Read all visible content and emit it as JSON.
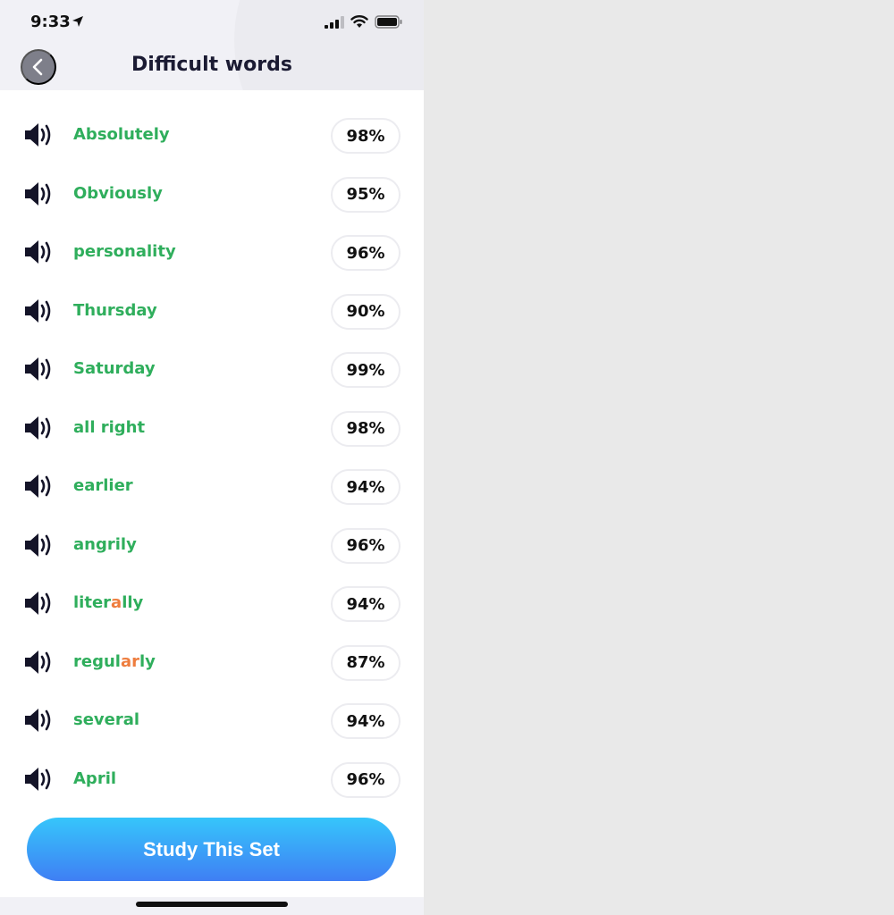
{
  "status_bar": {
    "time": "9:33",
    "icons": [
      "location-arrow-icon",
      "signal-icon",
      "wifi-icon",
      "battery-icon"
    ]
  },
  "header": {
    "title": "Difficult words",
    "back_icon": "chevron-left-icon"
  },
  "colors": {
    "word": "#2fae5c",
    "highlight": "#ee7d3e",
    "button_gradient_top": "#36c6fb",
    "button_gradient_bottom": "#3f7ff4"
  },
  "words": [
    {
      "parts": [
        {
          "t": "Absolutely"
        }
      ],
      "score": "98%"
    },
    {
      "parts": [
        {
          "t": "Obviously"
        }
      ],
      "score": "95%"
    },
    {
      "parts": [
        {
          "t": "personality"
        }
      ],
      "score": "96%"
    },
    {
      "parts": [
        {
          "t": "Thursday"
        }
      ],
      "score": "90%"
    },
    {
      "parts": [
        {
          "t": "Saturday"
        }
      ],
      "score": "99%"
    },
    {
      "parts": [
        {
          "t": "all right"
        }
      ],
      "score": "98%"
    },
    {
      "parts": [
        {
          "t": "earlier"
        }
      ],
      "score": "94%"
    },
    {
      "parts": [
        {
          "t": "angrily"
        }
      ],
      "score": "96%"
    },
    {
      "parts": [
        {
          "t": "liter"
        },
        {
          "t": "a",
          "hl": true
        },
        {
          "t": "lly"
        }
      ],
      "score": "94%"
    },
    {
      "parts": [
        {
          "t": "regul"
        },
        {
          "t": "ar",
          "hl": true
        },
        {
          "t": "ly"
        }
      ],
      "score": "87%"
    },
    {
      "parts": [
        {
          "t": "several"
        }
      ],
      "score": "94%"
    },
    {
      "parts": [
        {
          "t": "April"
        }
      ],
      "score": "96%"
    }
  ],
  "study_button": {
    "label": "Study This Set"
  }
}
